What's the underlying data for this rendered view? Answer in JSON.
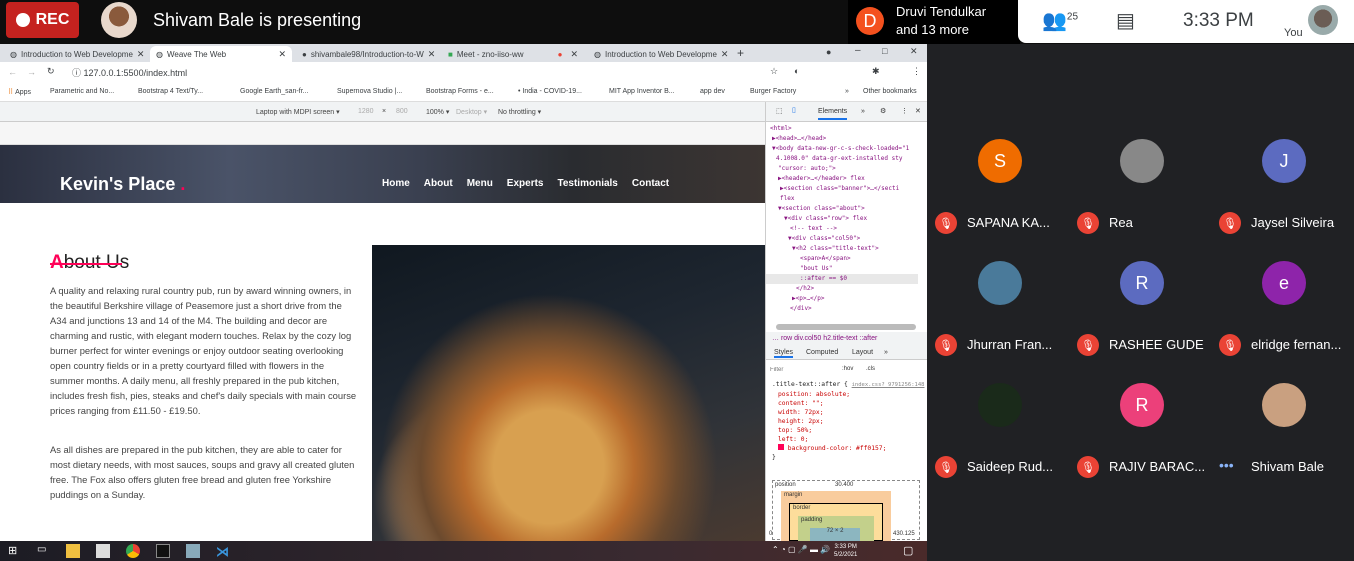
{
  "meet": {
    "rec": "REC",
    "presenting": "Shivam Bale is presenting",
    "speaker_initial": "D",
    "speaker_line1": "Druvi Tendulkar",
    "speaker_line2": "and 13 more",
    "people_count": "25",
    "clock": "3:33  PM",
    "you": "You"
  },
  "browser": {
    "tabs": [
      {
        "label": "Introduction to Web Developme"
      },
      {
        "label": "Weave The Web",
        "active": true
      },
      {
        "label": "shivambale98/Introduction-to-W"
      },
      {
        "label": "Meet - zno-iiso-ww"
      },
      {
        "label": "Introduction to Web Developme"
      }
    ],
    "url": "127.0.0.1:5500/index.html",
    "bookmarks": [
      "Apps",
      "Parametric and No...",
      "Bootstrap 4 Text/Ty...",
      "Google Earth_san-fr...",
      "Supernova Studio |...",
      "Bootstrap Forms - e...",
      "• India - COVID-19...",
      "MIT App Inventor B...",
      "app dev",
      "Burger Factory",
      "»",
      "Other bookmarks"
    ],
    "device": {
      "preset": "Laptop with MDPI screen ▾",
      "width": "1280",
      "x": "×",
      "height": "800",
      "zoom": "100% ▾",
      "mode": "Desktop ▾",
      "throttle": "No throttling ▾"
    }
  },
  "site": {
    "logo": "Kevin's Place",
    "logo_dot": ".",
    "nav": [
      "Home",
      "About",
      "Menu",
      "Experts",
      "Testimonials",
      "Contact"
    ],
    "title_first": "A",
    "title_rest": "bout Us",
    "para1": "A quality and relaxing rural country pub, run by award winning owners, in the beautiful Berkshire village of Peasemore just a short drive from the A34 and junctions 13 and 14 of the M4. The building and decor are charming and rustic, with elegant modern touches. Relax by the cozy log burner perfect for winter evenings or enjoy outdoor seating overlooking open country fields or in a pretty courtyard filled with flowers in the summer months. A daily menu, all freshly prepared in the pub kitchen, includes fresh fish, pies, steaks and chef's daily specials with main course prices ranging from £11.50 - £19.50.",
    "para2": "As all dishes are prepared in the pub kitchen, they are able to cater for most dietary needs, with most sauces, soups and gravy all created gluten free. The Fox also offers gluten free bread and gluten free Yorkshire puddings on a Sunday.",
    "accent": "#ff0157"
  },
  "devtools": {
    "tab": "Elements",
    "more": "»",
    "dom": [
      "<html>",
      "▶<head>…</head>",
      "▼<body data-new-gr-c-s-check-loaded=\"1",
      "4.1008.0\" data-gr-ext-installed sty",
      "\"cursor: auto;\">",
      "▶<header>…</header> flex",
      "▶<section class=\"banner\">…</secti",
      " flex",
      "▼<section class=\"about\">",
      "▼<div class=\"row\"> flex",
      "<!-- text  -->",
      "▼<div class=\"col50\">",
      "▼<h2 class=\"title-text\">",
      "<span>A</span>",
      "\"bout Us\"",
      "::after == $0",
      "</h2>",
      "▶<p>…</p>",
      "</div>"
    ],
    "crumbs": "…  row   div.col50   h2.title-text   ::after",
    "style_tabs": [
      "Styles",
      "Computed",
      "Layout",
      "»"
    ],
    "filter_placeholder": "Filter",
    "hov": ":hov",
    "cls": ".cls",
    "rule_selector": ".title-text::after {",
    "rule_source": "index.css?_9791256:148",
    "props": [
      "position: absolute;",
      "content: \"\";",
      "width: 72px;",
      "height: 2px;",
      "top: 50%;",
      "left: 0;",
      "background-color: #ff0157;"
    ],
    "rule_end": "}",
    "box": {
      "position": "position",
      "pos_val": "30.400",
      "margin": "margin",
      "border": "border",
      "padding": "padding",
      "content": "72 × 2",
      "dash": "–",
      "left": "0",
      "right": "430.125"
    }
  },
  "taskbar": {
    "time": "3:33 PM",
    "date": "5/2/2021"
  },
  "participants": [
    {
      "initial": "S",
      "name": "SAPANA KA...",
      "color": "#ef6c00",
      "muted": true
    },
    {
      "initial": "",
      "name": "Rea",
      "color": "#888888",
      "muted": true
    },
    {
      "initial": "J",
      "name": "Jaysel Silveira",
      "color": "#5c6bc0",
      "muted": true
    },
    {
      "initial": "",
      "name": "Jhurran Fran...",
      "color": "#4a7a9a",
      "muted": true
    },
    {
      "initial": "R",
      "name": "RASHEE GUDE",
      "color": "#5c6bc0",
      "muted": true
    },
    {
      "initial": "e",
      "name": "elridge fernan...",
      "color": "#8e24aa",
      "muted": true
    },
    {
      "initial": "",
      "name": "Saideep Rud...",
      "color": "#1a2a1a",
      "muted": true
    },
    {
      "initial": "R",
      "name": "RAJIV BARAC...",
      "color": "#ec407a",
      "muted": true
    },
    {
      "initial": "",
      "name": "Shivam Bale",
      "color": "#c9a080",
      "muted": false
    }
  ]
}
